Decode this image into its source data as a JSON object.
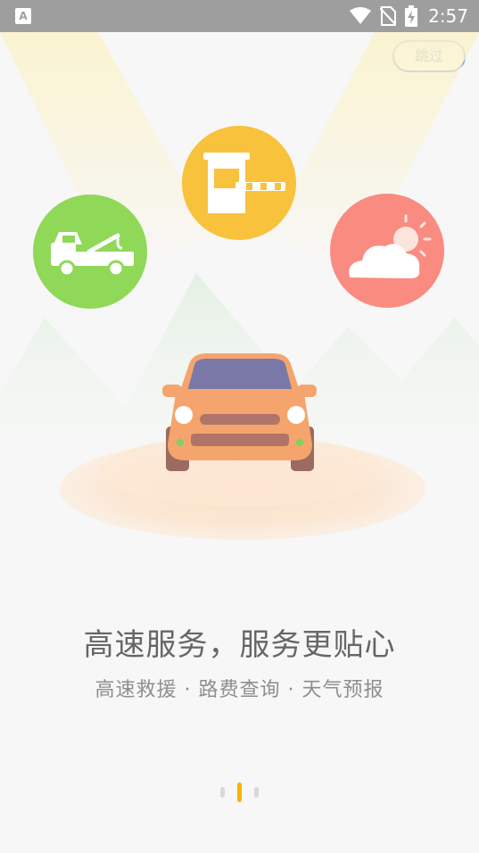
{
  "status_bar": {
    "app_icon_letter": "A",
    "time": "2:57",
    "icons": [
      "wifi-icon",
      "no-sim-icon",
      "battery-charging-icon"
    ]
  },
  "skip_button": {
    "label": "跳过"
  },
  "illustration": {
    "icons": [
      "tow-truck-icon",
      "toll-gate-icon",
      "weather-icon"
    ],
    "colors": {
      "tow_truck": "#8fd858",
      "toll_gate": "#f9c23c",
      "weather": "#f98b80",
      "car_body": "#f5a46e",
      "accent": "#f7b500"
    }
  },
  "headline": "高速服务，服务更贴心",
  "subline": "高速救援 · 路费查询 · 天气预报",
  "pager": {
    "total": 3,
    "active_index": 1
  }
}
